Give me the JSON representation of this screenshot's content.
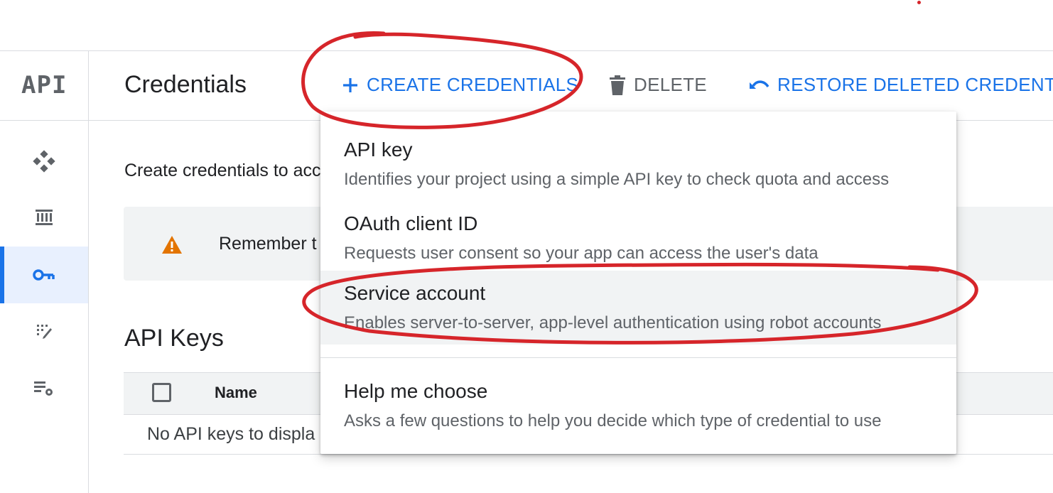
{
  "sidebar": {
    "logo": "API",
    "items": [
      {
        "icon": "dashboard-icon",
        "active": false
      },
      {
        "icon": "library-icon",
        "active": false
      },
      {
        "icon": "key-icon",
        "active": true
      },
      {
        "icon": "consent-icon",
        "active": false
      },
      {
        "icon": "settings-list-icon",
        "active": false
      }
    ]
  },
  "header": {
    "title": "Credentials",
    "create_label": "CREATE CREDENTIALS",
    "delete_label": "DELETE",
    "restore_label": "RESTORE DELETED CREDENTIALS"
  },
  "main": {
    "intro": "Create credentials to acc",
    "warning": "Remember t",
    "api_keys_title": "API Keys",
    "table": {
      "columns": [
        "Name"
      ],
      "empty_text": "No API keys to displa"
    }
  },
  "menu": {
    "items": [
      {
        "title": "API key",
        "description": "Identifies your project using a simple API key to check quota and access"
      },
      {
        "title": "OAuth client ID",
        "description": "Requests user consent so your app can access the user's data"
      },
      {
        "title": "Service account",
        "description": "Enables server-to-server, app-level authentication using robot accounts"
      },
      {
        "title": "Help me choose",
        "description": "Asks a few questions to help you decide which type of credential to use"
      }
    ]
  },
  "colors": {
    "accent": "#1a73e8",
    "warning": "#e37400",
    "annotation": "#d6252a"
  }
}
